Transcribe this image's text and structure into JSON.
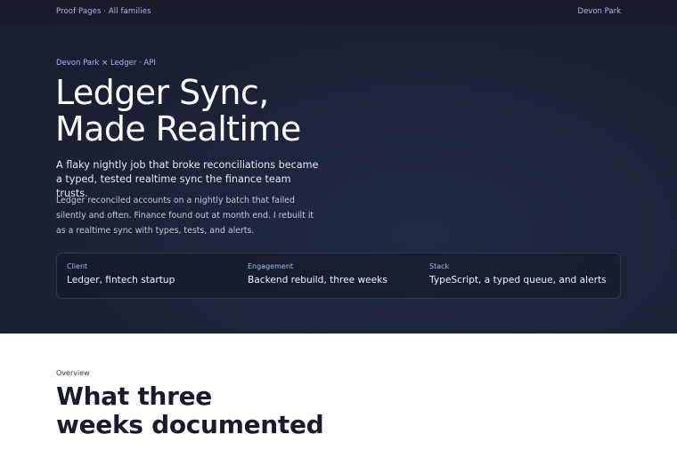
{
  "topbar": {
    "nav_left": "Proof Pages · All families",
    "nav_right": "Devon Park"
  },
  "hero": {
    "eyebrow": "Devon Park × Ledger · API",
    "title_line1": "Ledger Sync,",
    "title_line2": "Made Realtime",
    "lede": "A flaky nightly job that broke reconciliations became a typed, tested realtime sync the finance team trusts.",
    "body": "Ledger reconciled accounts on a nightly batch that failed silently and often. Finance found out at month end. I rebuilt it as a realtime sync with types, tests, and alerts."
  },
  "meta": {
    "client_label": "Client",
    "client_value": "Ledger, fintech startup",
    "engagement_label": "Engagement",
    "engagement_value": "Backend rebuild, three weeks",
    "stack_label": "Stack",
    "stack_value": "TypeScript, a typed queue, and alerts"
  },
  "overview": {
    "kicker": "Overview",
    "heading_line1": "What three",
    "heading_line2": "weeks documented"
  },
  "colors": {
    "hero_bg": "#1a2035",
    "accent": "#aab6f5",
    "text_dark": "#171b2e"
  }
}
